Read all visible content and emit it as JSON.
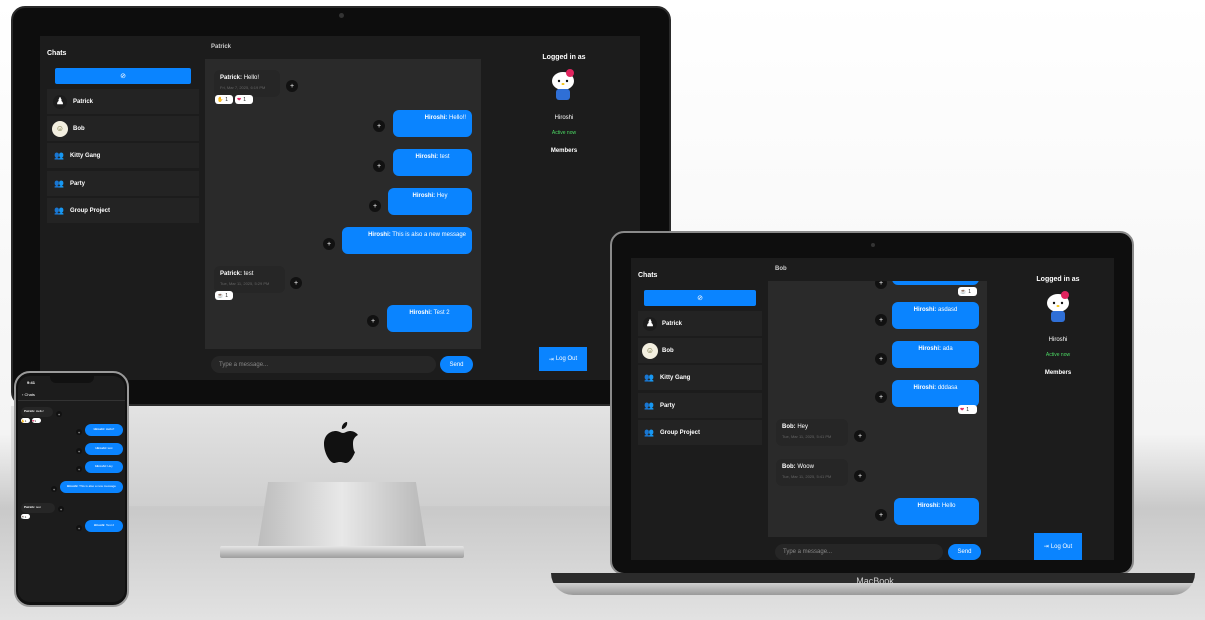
{
  "app": {
    "sidebar_title": "Chats",
    "new_chat_icon": "new-chat-icon",
    "chats": [
      {
        "name": "Patrick",
        "icon": "avatar-patrick"
      },
      {
        "name": "Bob",
        "icon": "avatar-bob"
      },
      {
        "name": "Kitty Gang",
        "icon": "group-icon"
      },
      {
        "name": "Party",
        "icon": "group-icon"
      },
      {
        "name": "Group Project",
        "icon": "group-icon"
      }
    ],
    "logged_in_label": "Logged in as",
    "user_name": "Hiroshi",
    "status": "Active now",
    "members_label": "Members",
    "logout_label": "Log Out",
    "input_placeholder": "Type a message...",
    "send_label": "Send",
    "react_glyph": "+",
    "colors": {
      "accent": "#0a84ff",
      "active": "#4cd964",
      "background": "#1c1c1c"
    }
  },
  "desktop_chat": {
    "header": "Patrick",
    "messages": [
      {
        "dir": "in",
        "sender": "Patrick:",
        "text": "Hello!",
        "time": "Fri, Mar 7, 2025, 6:19 PM",
        "reactions": [
          "1",
          "1"
        ]
      },
      {
        "dir": "out",
        "sender": "Hiroshi:",
        "text": "Hello!!"
      },
      {
        "dir": "out",
        "sender": "Hiroshi:",
        "text": "test"
      },
      {
        "dir": "out",
        "sender": "Hiroshi:",
        "text": "Hey"
      },
      {
        "dir": "out",
        "sender": "Hiroshi:",
        "text": "This is also a new message"
      },
      {
        "dir": "in",
        "sender": "Patrick:",
        "text": "test",
        "time": "Tue, Mar 11, 2025, 5:29 PM",
        "reactions": [
          "1"
        ]
      },
      {
        "dir": "out",
        "sender": "Hiroshi:",
        "text": "Test 2"
      }
    ]
  },
  "laptop_chat": {
    "header": "Bob",
    "top_reaction": "1",
    "messages": [
      {
        "dir": "out",
        "sender": "Hiroshi:",
        "text": "asdasd"
      },
      {
        "dir": "out",
        "sender": "Hiroshi:",
        "text": "ada"
      },
      {
        "dir": "out",
        "sender": "Hiroshi:",
        "text": "dddasa",
        "reaction": "1"
      },
      {
        "dir": "in",
        "sender": "Bob:",
        "text": "Hey",
        "time": "Tue, Mar 11, 2025, 5:41 PM"
      },
      {
        "dir": "in",
        "sender": "Bob:",
        "text": "Woow",
        "time": "Tue, Mar 11, 2025, 5:41 PM"
      },
      {
        "dir": "out",
        "sender": "Hiroshi:",
        "text": "Hello"
      }
    ]
  },
  "phone": {
    "status_time": "9:41",
    "back_label": "Chats"
  },
  "devices": {
    "laptop_brand": "MacBook"
  }
}
